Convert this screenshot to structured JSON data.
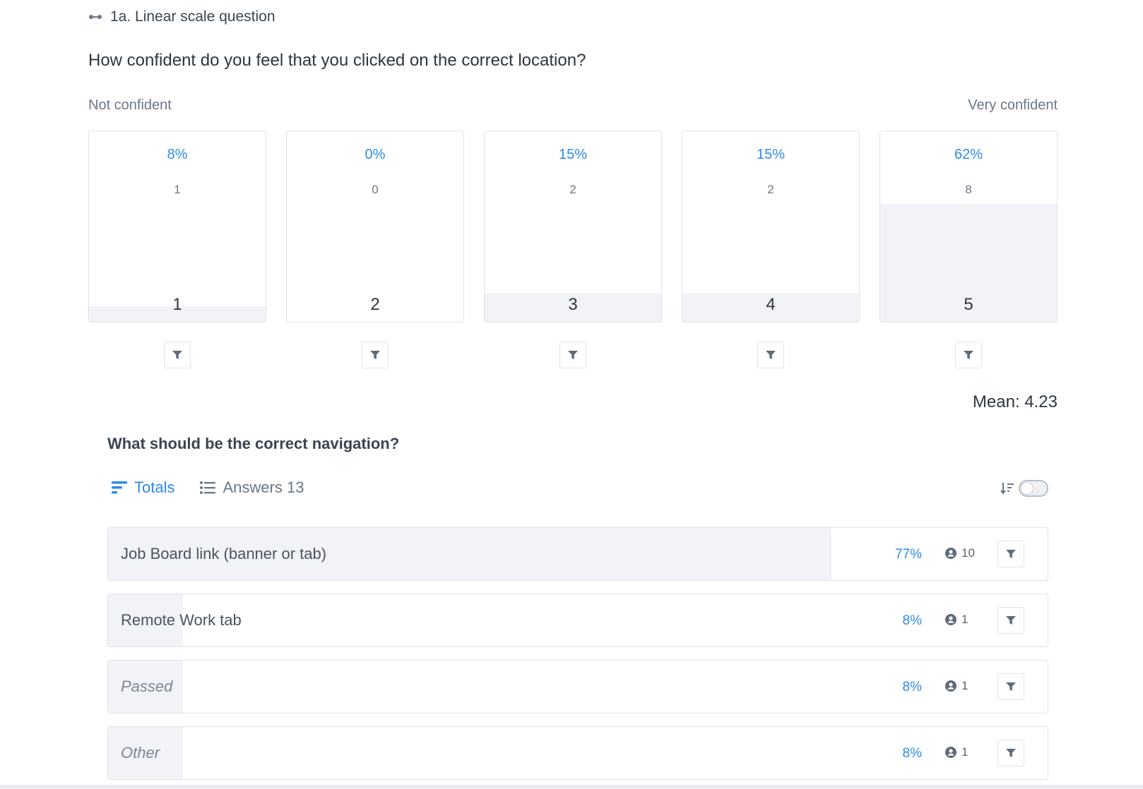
{
  "section": {
    "title": "1a. Linear scale question",
    "icon": "linear-scale-icon"
  },
  "question": "How confident do you feel that you clicked on the correct location?",
  "scale": {
    "min_label": "Not confident",
    "max_label": "Very confident",
    "options": [
      {
        "value": "1",
        "percent_label": "8%",
        "count": "1",
        "share": 0.08
      },
      {
        "value": "2",
        "percent_label": "0%",
        "count": "0",
        "share": 0.0
      },
      {
        "value": "3",
        "percent_label": "15%",
        "count": "2",
        "share": 0.15
      },
      {
        "value": "4",
        "percent_label": "15%",
        "count": "2",
        "share": 0.15
      },
      {
        "value": "5",
        "percent_label": "62%",
        "count": "8",
        "share": 0.62
      }
    ],
    "mean": "Mean: 4.23"
  },
  "followup": {
    "question": "What should be the correct navigation?",
    "tabs": {
      "totals": "Totals",
      "answers": "Answers 13"
    },
    "answers": [
      {
        "label": "Job Board link (banner or tab)",
        "percent_label": "77%",
        "count": "10",
        "share": 0.77,
        "italic": false
      },
      {
        "label": "Remote Work tab",
        "percent_label": "8%",
        "count": "1",
        "share": 0.08,
        "italic": false
      },
      {
        "label": "Passed",
        "percent_label": "8%",
        "count": "1",
        "share": 0.08,
        "italic": true
      },
      {
        "label": "Other",
        "percent_label": "8%",
        "count": "1",
        "share": 0.08,
        "italic": true
      }
    ]
  },
  "colors": {
    "accent": "#2f8be6",
    "fill": "#f1f3f6",
    "border": "#dfe3e8",
    "muted": "#6b7785"
  }
}
